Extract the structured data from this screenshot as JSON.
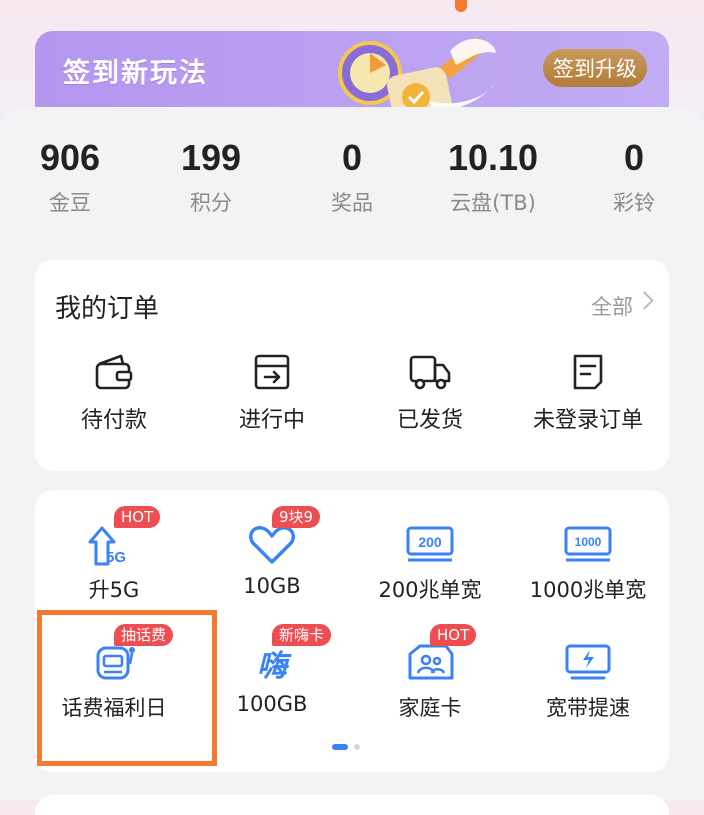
{
  "banner": {
    "title": "签到新玩法",
    "button": "签到升级"
  },
  "stats": [
    {
      "value": "906",
      "label": "金豆"
    },
    {
      "value": "199",
      "label": "积分"
    },
    {
      "value": "0",
      "label": "奖品"
    },
    {
      "value": "10.10",
      "label": "云盘(TB)"
    },
    {
      "value": "0",
      "label": "彩铃"
    }
  ],
  "orders": {
    "title": "我的订单",
    "all": "全部",
    "items": [
      {
        "label": "待付款",
        "icon": "wallet-icon"
      },
      {
        "label": "进行中",
        "icon": "inbox-icon"
      },
      {
        "label": "已发货",
        "icon": "truck-icon"
      },
      {
        "label": "未登录订单",
        "icon": "document-icon"
      }
    ]
  },
  "services": [
    {
      "label": "升5G",
      "badge": "HOT",
      "icon": "upgrade-5g-icon"
    },
    {
      "label": "10GB",
      "badge": "9块9",
      "icon": "heart-icon"
    },
    {
      "label": "200兆单宽",
      "badge": "",
      "icon": "broadband-200-icon",
      "icon_text": "200"
    },
    {
      "label": "1000兆单宽",
      "badge": "",
      "icon": "broadband-1000-icon",
      "icon_text": "1000"
    },
    {
      "label": "话费福利日",
      "badge": "抽话费",
      "icon": "slot-machine-icon"
    },
    {
      "label": "100GB",
      "badge": "新嗨卡",
      "icon": "hai-card-icon",
      "icon_text": "嗨"
    },
    {
      "label": "家庭卡",
      "badge": "HOT",
      "icon": "family-card-icon"
    },
    {
      "label": "宽带提速",
      "badge": "",
      "icon": "speedup-monitor-icon"
    }
  ],
  "colors": {
    "accent": "#3b82f6",
    "badge": "#ee4d52",
    "highlight": "#f5792f",
    "banner": "#b496ef"
  }
}
